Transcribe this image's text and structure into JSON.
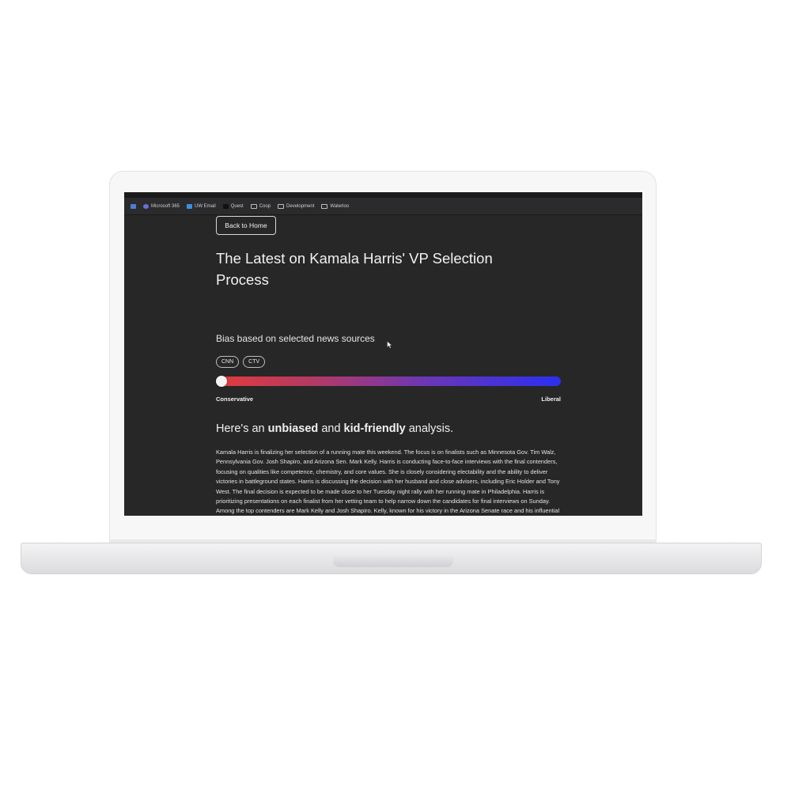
{
  "bookmarks": [
    {
      "label": "",
      "icon": "app-grid-icon",
      "color": "#4a7fd6"
    },
    {
      "label": "Microsoft 365",
      "icon": "microsoft-icon",
      "color": "#6b6fd8"
    },
    {
      "label": "UW Email",
      "icon": "outlook-icon",
      "color": "#3a8ee6"
    },
    {
      "label": "Quest",
      "icon": "quest-icon",
      "color": "#222222"
    },
    {
      "label": "Coop",
      "icon": "folder-icon",
      "color": ""
    },
    {
      "label": "Development",
      "icon": "folder-icon",
      "color": ""
    },
    {
      "label": "Waterloo",
      "icon": "folder-icon",
      "color": ""
    }
  ],
  "page": {
    "back_label": "Back to Home",
    "title": "The Latest on Kamala Harris' VP Selection Process",
    "bias_label": "Bias based on selected news sources",
    "sources": [
      "CNN",
      "CTV"
    ],
    "bias_value": 0.0,
    "scale_left": "Conservative",
    "scale_right": "Liberal",
    "analysis_heading": {
      "pre": "Here's an ",
      "bold1": "unbiased",
      "mid": " and ",
      "bold2": "kid-friendly",
      "post": " analysis."
    },
    "analysis_body": "Kamala Harris is finalizing her selection of a running mate this weekend. The focus is on finalists such as Minnesota Gov. Tim Walz, Pennsylvania Gov. Josh Shapiro, and Arizona Sen. Mark Kelly. Harris is conducting face-to-face interviews with the final contenders, focusing on qualities like competence, chemistry, and core values. She is closely considering electability and the ability to deliver victories in battleground states. Harris is discussing the decision with her husband and close advisers, including Eric Holder and Tony West. The final decision is expected to be made close to her Tuesday night rally with her running mate in Philadelphia. Harris is prioritizing presentations on each finalist from her vetting team to help narrow down the candidates for final interviews on Sunday. Among the top contenders are Mark Kelly and Josh Shapiro. Kelly, known for his victory in the Arizona Senate race and his influential role on important committees, is viewed favorably by many Democrats."
  },
  "colors": {
    "background": "#272727",
    "conservative": "#e23b3b",
    "liberal": "#2b2ff0"
  }
}
